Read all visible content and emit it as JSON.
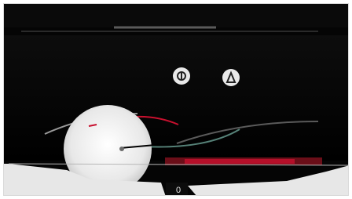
{
  "scene": {
    "top_label": "",
    "icons": [
      {
        "name": "steering-wheel-icon",
        "glyph": "⊕"
      },
      {
        "name": "seatbelt-icon",
        "glyph": "♀"
      }
    ],
    "colors": {
      "background": "#050505",
      "accent_red": "#c8102e",
      "teal_trace": "#8fd8c8",
      "white_shape": "#f2f2f2",
      "gray_line": "#9a9a9a"
    },
    "bottom_marker": "0"
  }
}
